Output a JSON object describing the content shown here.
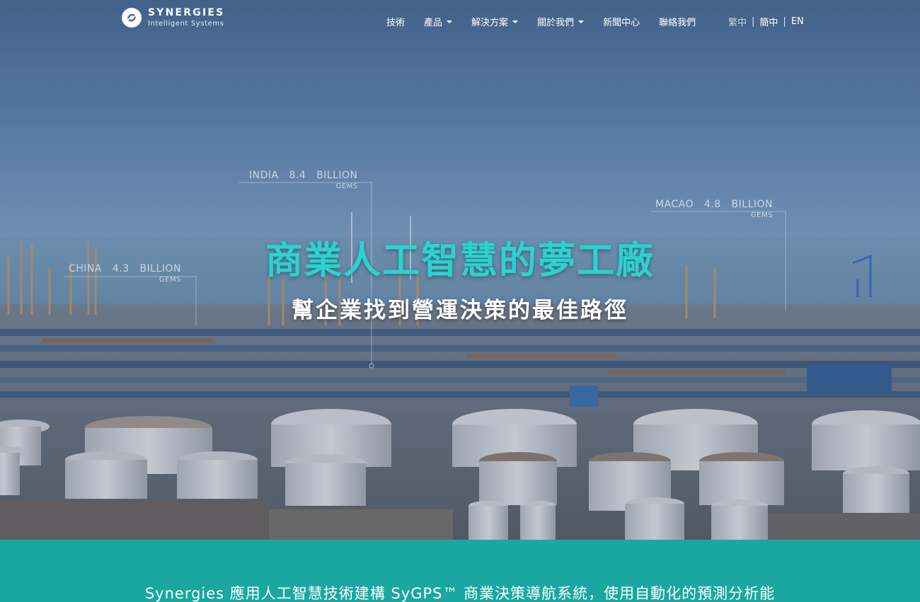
{
  "brand": {
    "name": "SYNERGIES",
    "tagline": "Intelligent Systems"
  },
  "nav": {
    "items": [
      {
        "label": "技術",
        "has_dropdown": false
      },
      {
        "label": "產品",
        "has_dropdown": true
      },
      {
        "label": "解決方案",
        "has_dropdown": true
      },
      {
        "label": "關於我們",
        "has_dropdown": true
      },
      {
        "label": "新聞中心",
        "has_dropdown": false
      },
      {
        "label": "聯絡我們",
        "has_dropdown": false
      }
    ]
  },
  "language": {
    "options": [
      "繁中",
      "簡中",
      "EN"
    ],
    "separator": "|",
    "active": "繁中"
  },
  "hero": {
    "title": "商業人工智慧的夢工廠",
    "subtitle": "幫企業找到營運決策的最佳路徑",
    "overlays": [
      {
        "region": "INDIA",
        "value": "8.4",
        "unit": "BILLION",
        "sub": "GEMS"
      },
      {
        "region": "CHINA",
        "value": "4.3",
        "unit": "BILLION",
        "sub": "GEMS"
      },
      {
        "region": "MACAO",
        "value": "4.8",
        "unit": "BILLION",
        "sub": "GEMS"
      }
    ]
  },
  "band": {
    "text": "Synergies 應用人工智慧技術建構 SyGPS™ 商業決策導航系統，使用自動化的預測分析能"
  },
  "colors": {
    "accent_teal": "#2ad3cf",
    "band_teal": "#1aa7a2",
    "text_white": "#ffffff"
  }
}
